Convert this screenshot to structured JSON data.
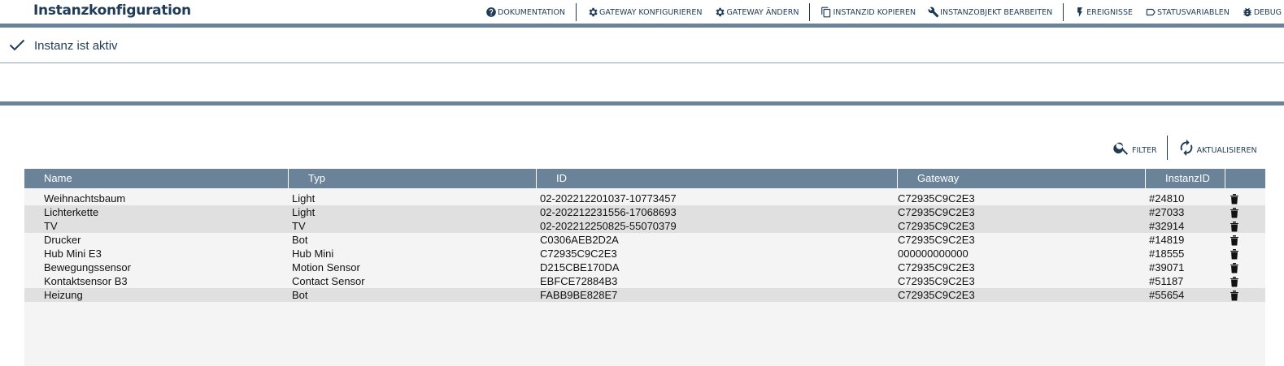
{
  "header": {
    "title": "Instanzkonfiguration",
    "toolbar": {
      "documentation": "DOKUMENTATION",
      "gateway_configure": "GATEWAY KONFIGURIEREN",
      "gateway_change": "GATEWAY ÄNDERN",
      "copy_id": "INSTANZID KOPIEREN",
      "edit_object": "INSTANZOBJEKT BEARBEITEN",
      "events": "EREIGNISSE",
      "status_vars": "STATUSVARIABLEN",
      "debug": "DEBUG"
    }
  },
  "status": {
    "text": "Instanz ist aktiv"
  },
  "actions": {
    "filter": "FILTER",
    "refresh": "AKTUALISIEREN"
  },
  "table": {
    "columns": [
      "Name",
      "Typ",
      "ID",
      "Gateway",
      "InstanzID"
    ],
    "rows": [
      {
        "name": "Weihnachtsbaum",
        "type": "Light",
        "id": "02-202212201037-10773457",
        "gateway": "C72935C9C2E3",
        "instance_id": "#24810"
      },
      {
        "name": "Lichterkette",
        "type": "Light",
        "id": "02-202212231556-17068693",
        "gateway": "C72935C9C2E3",
        "instance_id": "#27033"
      },
      {
        "name": "TV",
        "type": "TV",
        "id": "02-202212250825-55070379",
        "gateway": "C72935C9C2E3",
        "instance_id": "#32914"
      },
      {
        "name": "Drucker",
        "type": "Bot",
        "id": "C0306AEB2D2A",
        "gateway": "C72935C9C2E3",
        "instance_id": "#14819"
      },
      {
        "name": "Hub Mini E3",
        "type": "Hub Mini",
        "id": "C72935C9C2E3",
        "gateway": "000000000000",
        "instance_id": "#18555"
      },
      {
        "name": "Bewegungssensor",
        "type": "Motion Sensor",
        "id": "D215CBE170DA",
        "gateway": "C72935C9C2E3",
        "instance_id": "#39071"
      },
      {
        "name": "Kontaktsensor B3",
        "type": "Contact Sensor",
        "id": "EBFCE72884B3",
        "gateway": "C72935C9C2E3",
        "instance_id": "#51187"
      },
      {
        "name": "Heizung",
        "type": "Bot",
        "id": "FABB9BE828E7",
        "gateway": "C72935C9C2E3",
        "instance_id": "#55654"
      }
    ]
  },
  "icons": {
    "toolbar": [
      "help-circle-icon",
      "gear-icon",
      "gear-icon",
      "copy-icon",
      "wrench-icon",
      "flash-icon",
      "label-icon",
      "bug-icon"
    ],
    "status": "check-icon",
    "filter": "search-icon",
    "refresh": "refresh-icon",
    "row_action": "trash-icon"
  },
  "colors": {
    "primary": "#1f3b57",
    "header_bar": "#6b8399",
    "row_alt": "#e0e0e0",
    "row": "#f4f4f4"
  }
}
